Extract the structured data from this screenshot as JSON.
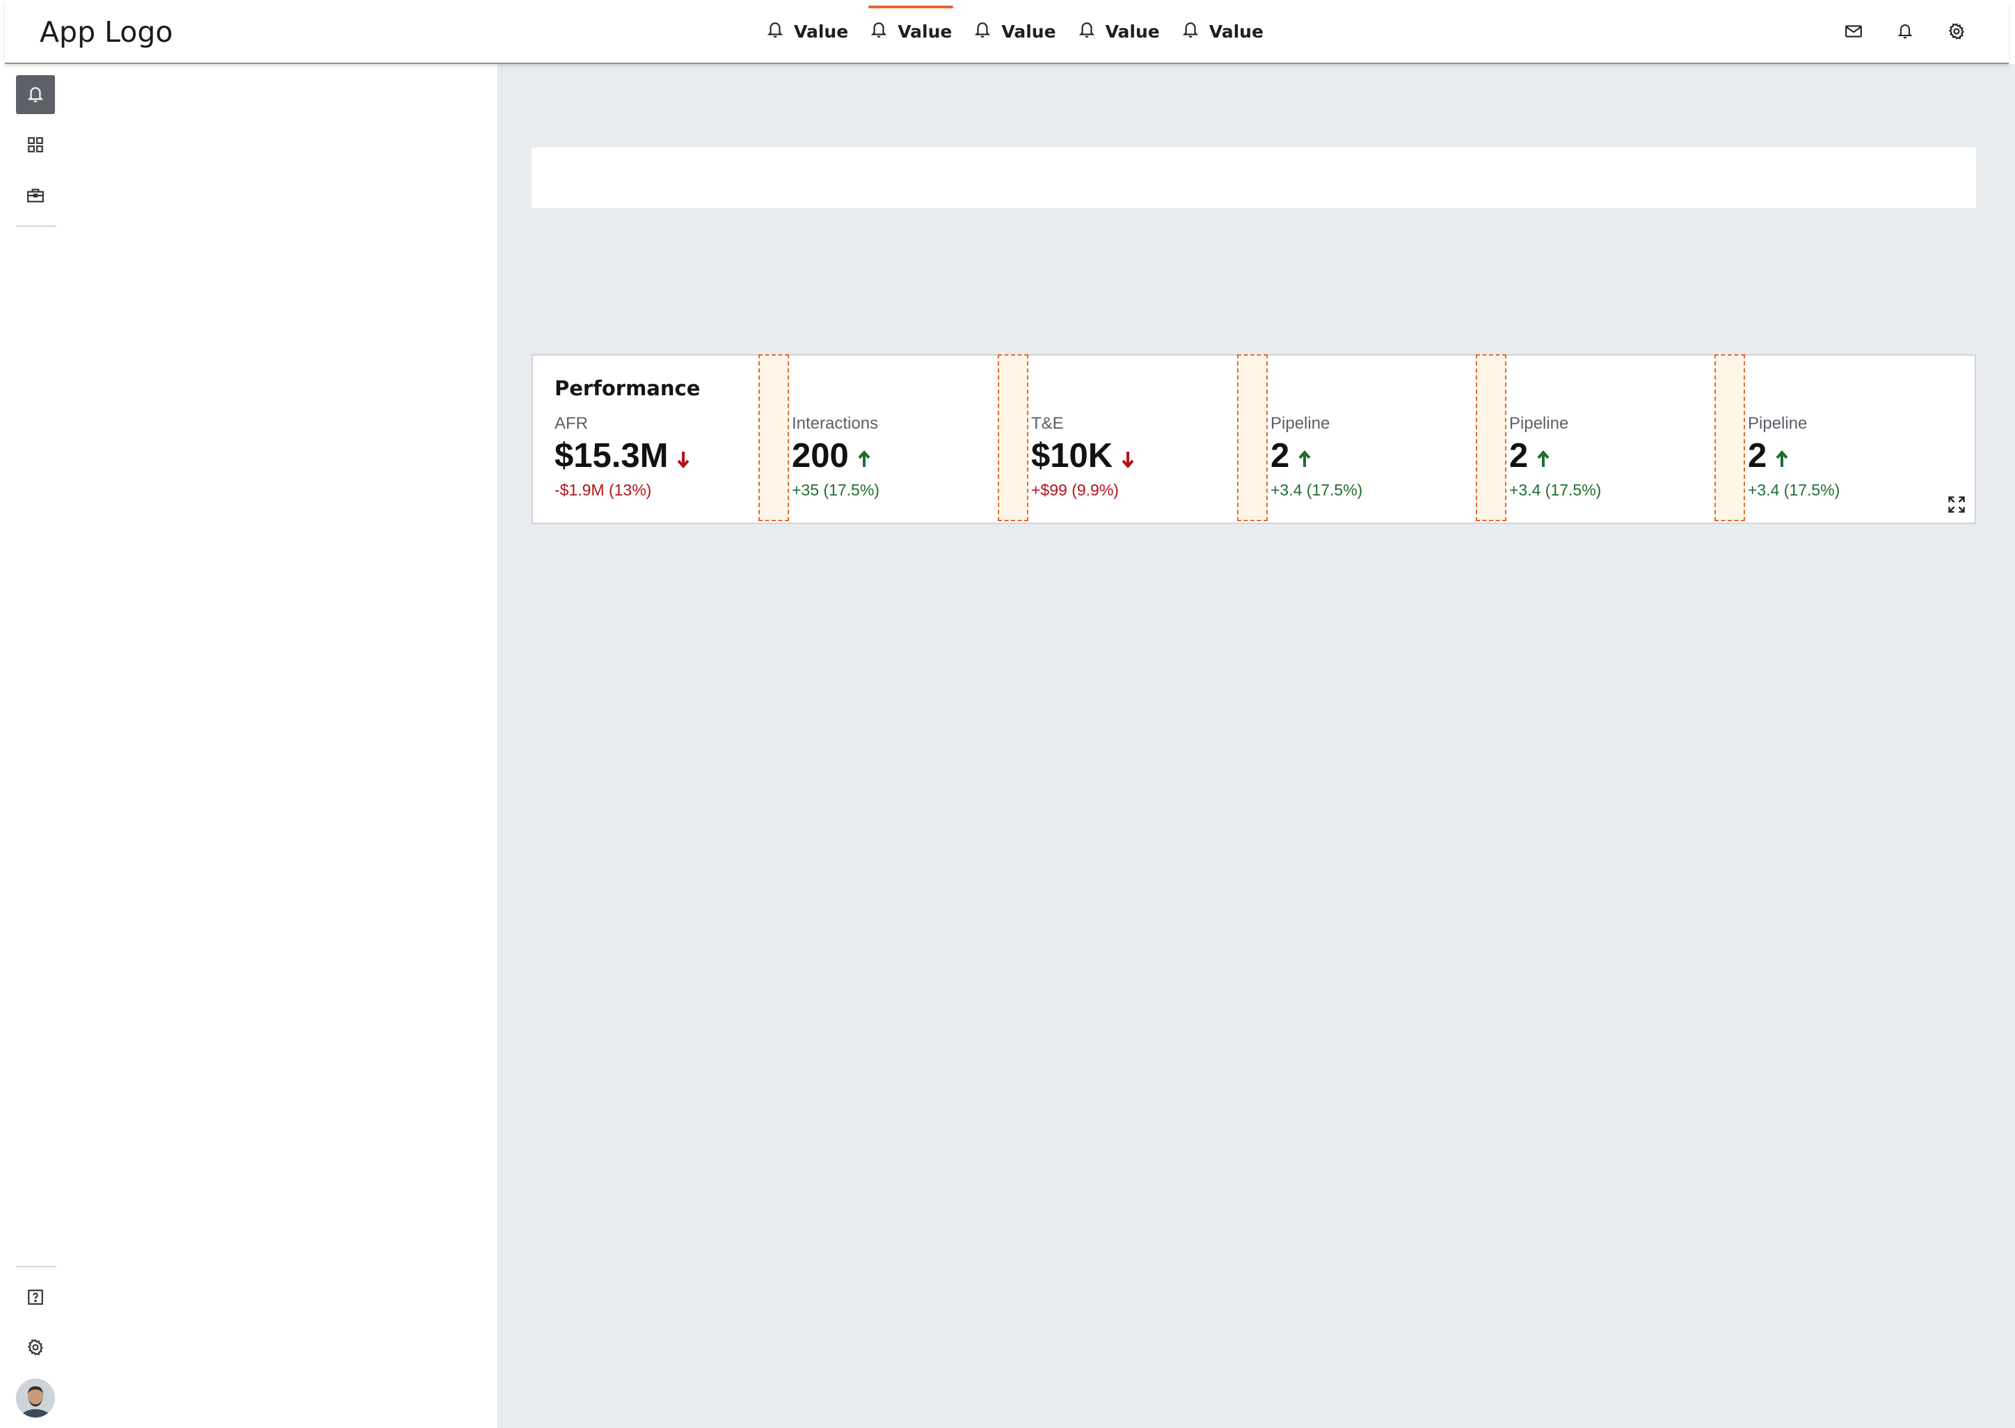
{
  "header": {
    "app_logo": "App Logo",
    "nav_items": [
      {
        "label": "Value",
        "icon": "bell-icon",
        "active": false
      },
      {
        "label": "Value",
        "icon": "bell-icon",
        "active": true
      },
      {
        "label": "Value",
        "icon": "bell-icon",
        "active": false
      },
      {
        "label": "Value",
        "icon": "bell-icon",
        "active": false
      },
      {
        "label": "Value",
        "icon": "bell-icon",
        "active": false
      }
    ],
    "actions": [
      "mail-icon",
      "bell-icon",
      "gear-icon"
    ]
  },
  "rail": {
    "top_items": [
      "bell-icon",
      "grid-icon",
      "briefcase-icon"
    ],
    "active_item": "bell-icon",
    "bottom_items": [
      "help-icon",
      "gear-icon",
      "avatar"
    ]
  },
  "performance": {
    "title": "Performance",
    "metrics": [
      {
        "label": "AFR",
        "value": "$15.3M",
        "trend": "down",
        "delta": "-$1.9M (13%)",
        "delta_status": "negative"
      },
      {
        "label": "Interactions",
        "value": "200",
        "trend": "up",
        "delta": "+35 (17.5%)",
        "delta_status": "positive"
      },
      {
        "label": "T&E",
        "value": "$10K",
        "trend": "down",
        "delta": "+$99 (9.9%)",
        "delta_status": "negative"
      },
      {
        "label": "Pipeline",
        "value": "2",
        "trend": "up",
        "delta": "+3.4 (17.5%)",
        "delta_status": "positive"
      },
      {
        "label": "Pipeline",
        "value": "2",
        "trend": "up",
        "delta": "+3.4 (17.5%)",
        "delta_status": "positive"
      },
      {
        "label": "Pipeline",
        "value": "2",
        "trend": "up",
        "delta": "+3.4 (17.5%)",
        "delta_status": "positive"
      }
    ]
  },
  "colors": {
    "accent": "#e8672d",
    "negative": "#b3141a",
    "positive": "#1f6e2e",
    "background": "#e8ecef",
    "rail_active": "#5d6066"
  }
}
